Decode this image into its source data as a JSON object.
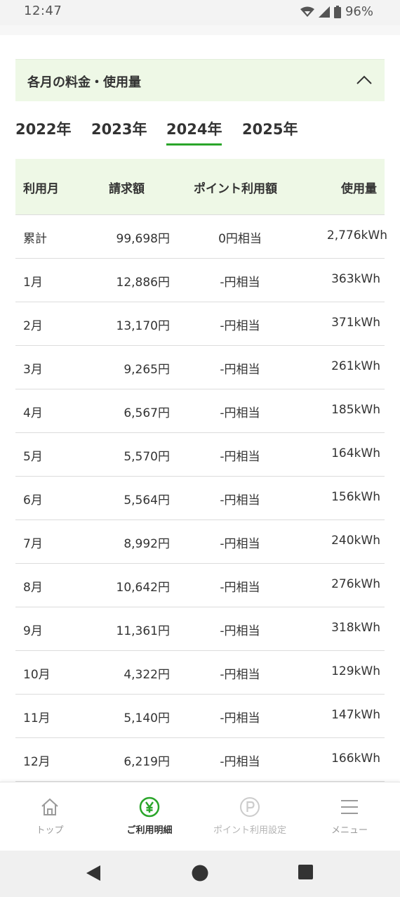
{
  "status_bar": {
    "time": "12:47",
    "battery": "96%"
  },
  "section": {
    "title": "各月の料金・使用量"
  },
  "year_tabs": [
    {
      "label": "2022年"
    },
    {
      "label": "2023年"
    },
    {
      "label": "2024年",
      "active": true
    },
    {
      "label": "2025年"
    }
  ],
  "table": {
    "headers": {
      "month": "利用月",
      "bill": "請求額",
      "points": "ポイント利用額",
      "usage": "使用量"
    },
    "rows": [
      {
        "month": "累計",
        "bill": "99,698円",
        "points": "0円相当",
        "usage": "2,776kWh"
      },
      {
        "month": "1月",
        "bill": "12,886円",
        "points": "-円相当",
        "usage": "363kWh"
      },
      {
        "month": "2月",
        "bill": "13,170円",
        "points": "-円相当",
        "usage": "371kWh"
      },
      {
        "month": "3月",
        "bill": "9,265円",
        "points": "-円相当",
        "usage": "261kWh"
      },
      {
        "month": "4月",
        "bill": "6,567円",
        "points": "-円相当",
        "usage": "185kWh"
      },
      {
        "month": "5月",
        "bill": "5,570円",
        "points": "-円相当",
        "usage": "164kWh"
      },
      {
        "month": "6月",
        "bill": "5,564円",
        "points": "-円相当",
        "usage": "156kWh"
      },
      {
        "month": "7月",
        "bill": "8,992円",
        "points": "-円相当",
        "usage": "240kWh"
      },
      {
        "month": "8月",
        "bill": "10,642円",
        "points": "-円相当",
        "usage": "276kWh"
      },
      {
        "month": "9月",
        "bill": "11,361円",
        "points": "-円相当",
        "usage": "318kWh"
      },
      {
        "month": "10月",
        "bill": "4,322円",
        "points": "-円相当",
        "usage": "129kWh"
      },
      {
        "month": "11月",
        "bill": "5,140円",
        "points": "-円相当",
        "usage": "147kWh"
      },
      {
        "month": "12月",
        "bill": "6,219円",
        "points": "-円相当",
        "usage": "166kWh"
      }
    ]
  },
  "bottom_nav": {
    "items": [
      {
        "label": "トップ",
        "icon": "home-icon"
      },
      {
        "label": "ご利用明細",
        "icon": "yen-icon",
        "active": true
      },
      {
        "label": "ポイント利用設定",
        "icon": "point-icon"
      },
      {
        "label": "メニュー",
        "icon": "menu-icon"
      }
    ]
  },
  "colors": {
    "accent_green": "#2aa52a",
    "header_bg": "#eef8e6"
  }
}
